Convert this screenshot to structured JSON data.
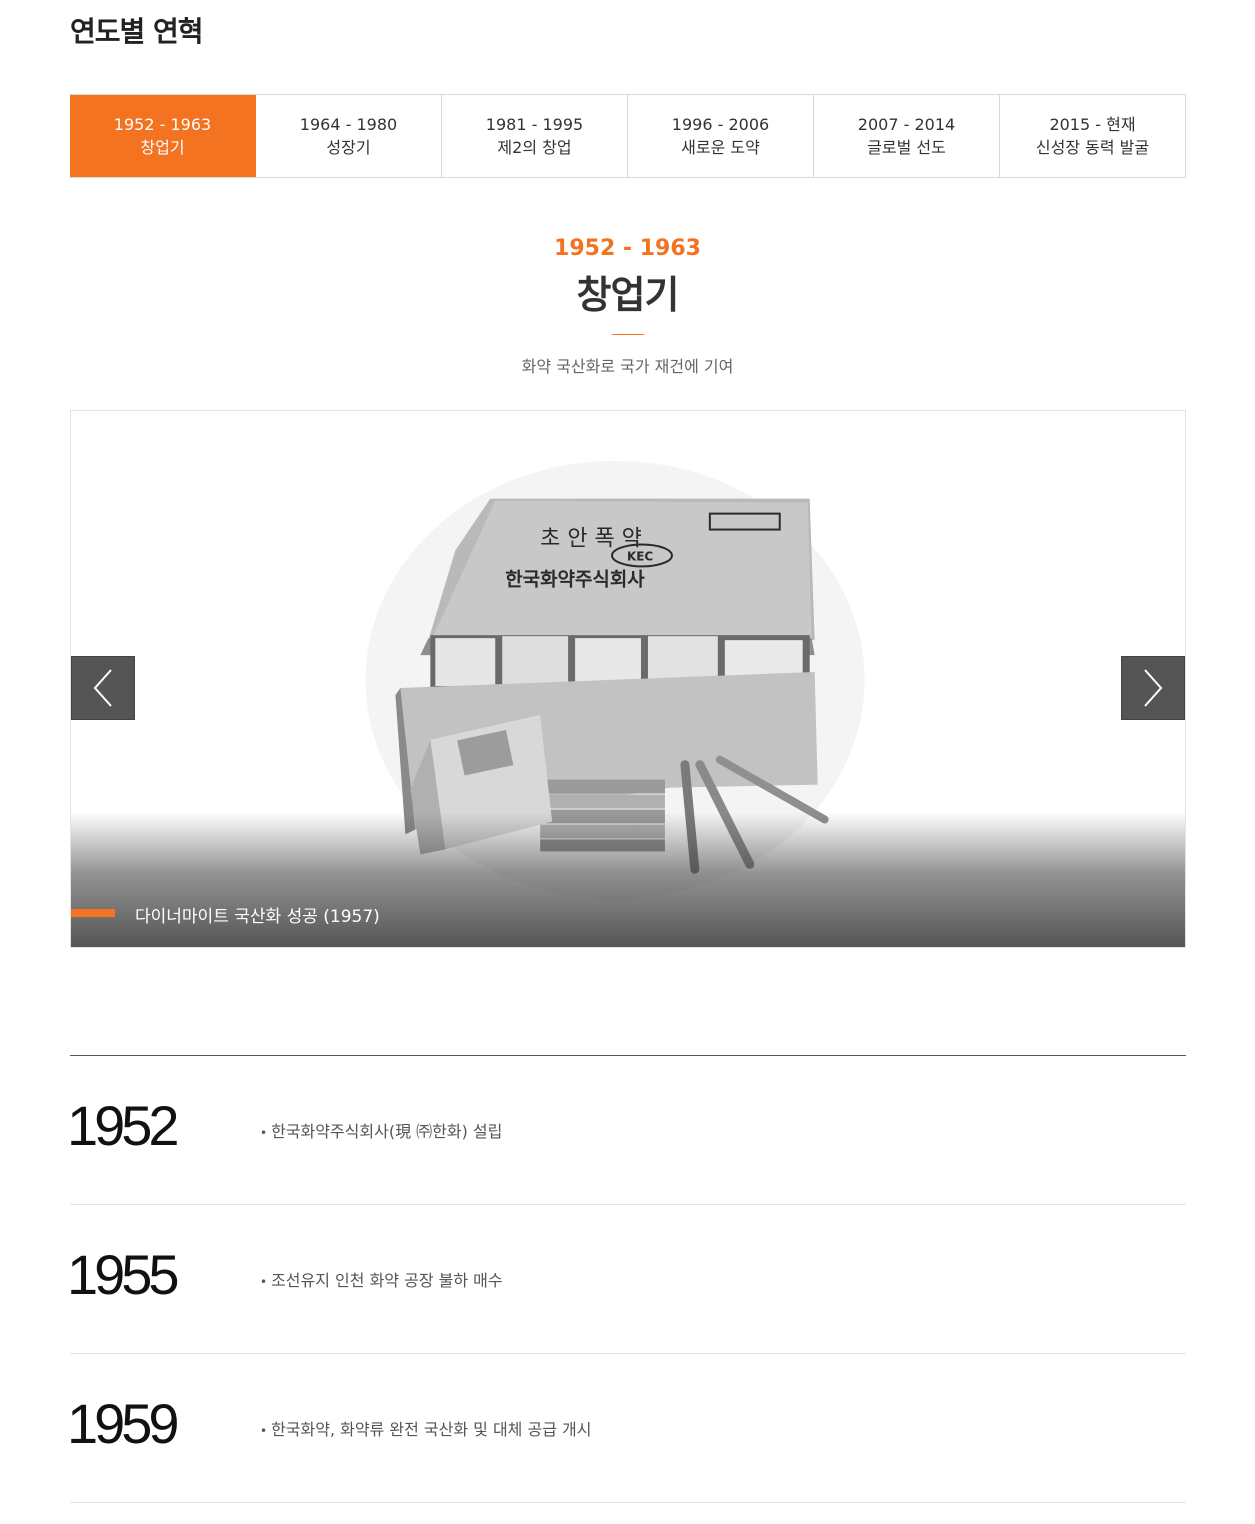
{
  "page_title": "연도별 연혁",
  "tabs": [
    {
      "years": "1952 - 1963",
      "name": "창업기"
    },
    {
      "years": "1964 - 1980",
      "name": "성장기"
    },
    {
      "years": "1981 - 1995",
      "name": "제2의 창업"
    },
    {
      "years": "1996 - 2006",
      "name": "새로운 도약"
    },
    {
      "years": "2007 - 2014",
      "name": "글로벌 선도"
    },
    {
      "years": "2015 - 현재",
      "name": "신성장 동력 발굴"
    }
  ],
  "era": {
    "years": "1952 - 1963",
    "title": "창업기",
    "description": "화약 국산화로 국가 재건에 기여"
  },
  "slider": {
    "caption": "다이너마이트 국산화 성공 (1957)",
    "box_text": {
      "line1": "초 안 폭 약",
      "badge": "KEC",
      "company": "한국화약주식회사"
    }
  },
  "timeline": [
    {
      "year": "1952",
      "event": "한국화약주식회사(現 ㈜한화) 설립"
    },
    {
      "year": "1955",
      "event": "조선유지 인천 화약 공장 불하 매수"
    },
    {
      "year": "1959",
      "event": "한국화약, 화약류 완전 국산화 및 대체 공급 개시"
    }
  ],
  "colors": {
    "accent": "#f37321",
    "arrow_bg": "#555555"
  }
}
